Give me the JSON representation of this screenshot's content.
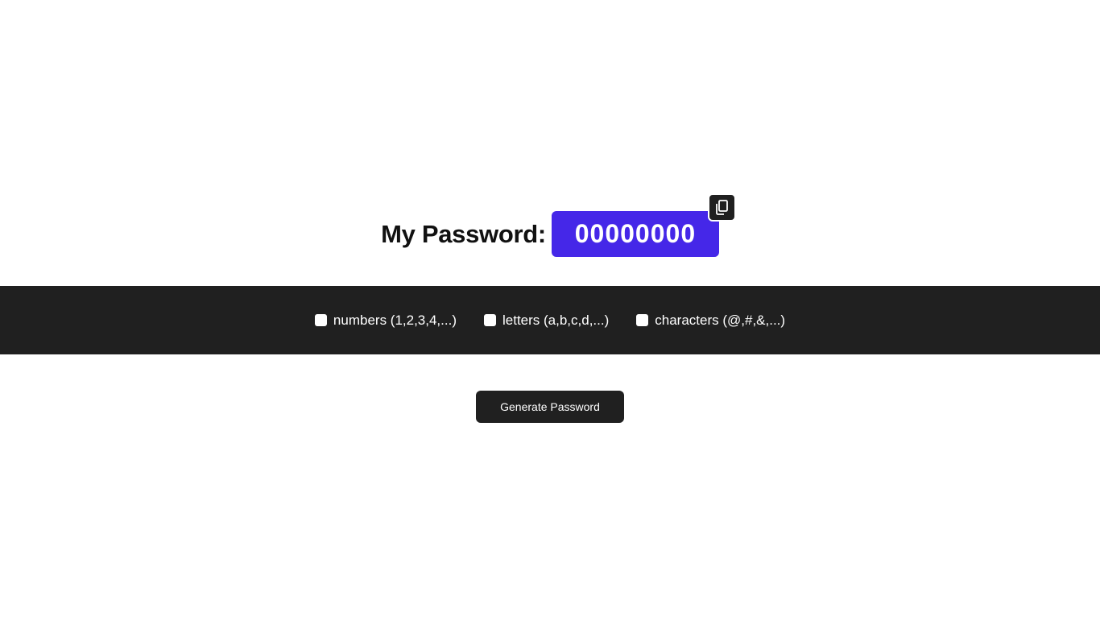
{
  "header": {
    "label": "My Password:",
    "password_value": "00000000"
  },
  "copy_button": {
    "icon": "copy-icon"
  },
  "options": [
    {
      "label": "numbers (1,2,3,4,...)",
      "checked": false
    },
    {
      "label": "letters (a,b,c,d,...)",
      "checked": false
    },
    {
      "label": "characters (@,#,&,...)",
      "checked": false
    }
  ],
  "generate_button": {
    "label": "Generate Password"
  },
  "colors": {
    "accent": "#4527E8",
    "dark": "#202020",
    "text": "#111111",
    "background": "#FFFFFF"
  }
}
